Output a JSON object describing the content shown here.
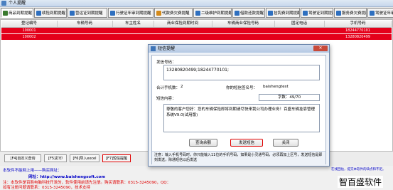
{
  "window": {
    "title": "个人提醒"
  },
  "tabs": [
    {
      "label": "商品到期提醒",
      "color": "#3a7a2f"
    },
    {
      "label": "续险到期提醒",
      "color": "#2e6fbf"
    },
    {
      "label": "营运证到期提醒",
      "color": "#2e6fbf"
    },
    {
      "label": "行驶证年审到期提醒",
      "color": "#2e6fbf"
    },
    {
      "label": "代款费欠费提醒",
      "color": "#d48a1a"
    },
    {
      "label": "二级维护到期提醒",
      "color": "#2e6fbf"
    },
    {
      "label": "借款还款提醒",
      "color": "#2e6fbf"
    },
    {
      "label": "挂钩费到期提醒",
      "color": "#2e6fbf"
    },
    {
      "label": "驾驶证到期提醒",
      "color": "#2e6fbf"
    },
    {
      "label": "服务费欠费提醒",
      "color": "#2e6fbf"
    },
    {
      "label": "驾驶证年审到期提醒",
      "color": "#2e6fbf"
    }
  ],
  "table": {
    "columns": [
      "登记编号",
      "车辆号码",
      "车主姓名",
      "商业保险到期时间",
      "车辆商业保险号码",
      "固定电话",
      "手机号码"
    ],
    "rows": [
      [
        "100001",
        "",
        "",
        "",
        "",
        "",
        "18244770101"
      ],
      [
        "100002",
        "",
        "",
        "",
        "",
        "",
        "13280820499"
      ]
    ]
  },
  "toolbar": {
    "buttons": [
      {
        "label": "[F4]自定义查询"
      },
      {
        "label": "[F5]打印"
      },
      {
        "label": "[F6]导入excel"
      },
      {
        "label": "[F7]短信提醒"
      }
    ]
  },
  "footer": {
    "line1_left": "本软件不能网上用——购买网址：",
    "line1_right": "在线回帖，提交本软件的缺点和不足。",
    "line2_url": "网址：http://www.baishengsoft.com",
    "line3": "注：本软件是百胜电脑科技开发的，软件使用前请先注册。购买请联系：0315-3245090，QQ：",
    "line4": "如有注册问题请联系：0315-3245090，技术支持",
    "watermark": "智百盛软件"
  },
  "dialog": {
    "title": "短信提醒",
    "close_label": "✕",
    "recipients_label": "发信号码：",
    "recipients_value": "13280820499;18244770101;",
    "count_label": "合计手机数：",
    "count_value": "2",
    "sender_label": "你的短信签名号：",
    "sender_value": "baishengtest",
    "content_label": "短信内容：",
    "char_count": "字数：49/70",
    "content_text": "尊敬的客户您好：您的车辆保险即将到期请尽快来我公司办理业务！百盛车辆挂靠管理系统V9.0(试用版)",
    "btn_query": "查询余额",
    "btn_send": "发送短信",
    "btn_close": "关闭",
    "note": "注意：输入手机号码时，你只能输入11位的手机号码，如果是小灵通号码，必须再加上区号，发送短信是即刻发送，除通短信以后发送"
  }
}
